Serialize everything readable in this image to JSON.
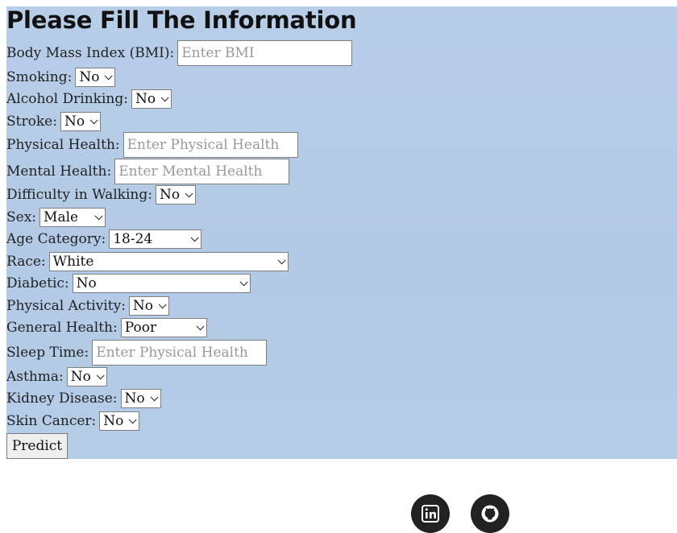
{
  "form": {
    "title": "Please Fill The Information",
    "bmi": {
      "label": "Body Mass Index (BMI):",
      "placeholder": "Enter BMI"
    },
    "smoking": {
      "label": "Smoking:",
      "value": "No"
    },
    "alcohol": {
      "label": "Alcohol Drinking:",
      "value": "No"
    },
    "stroke": {
      "label": "Stroke:",
      "value": "No"
    },
    "physical_health": {
      "label": "Physical Health:",
      "placeholder": "Enter Physical Health"
    },
    "mental_health": {
      "label": "Mental Health:",
      "placeholder": "Enter Mental Health"
    },
    "walking": {
      "label": "Difficulty in Walking:",
      "value": "No"
    },
    "sex": {
      "label": "Sex:",
      "value": "Male"
    },
    "age": {
      "label": "Age Category:",
      "value": "18-24"
    },
    "race": {
      "label": "Race:",
      "value": "White"
    },
    "diabetic": {
      "label": "Diabetic:",
      "value": "No"
    },
    "activity": {
      "label": "Physical Activity:",
      "value": "No"
    },
    "general_health": {
      "label": "General Health:",
      "value": "Poor"
    },
    "sleep": {
      "label": "Sleep Time:",
      "placeholder": "Enter Physical Health"
    },
    "asthma": {
      "label": "Asthma:",
      "value": "No"
    },
    "kidney": {
      "label": "Kidney Disease:",
      "value": "No"
    },
    "skin_cancer": {
      "label": "Skin Cancer:",
      "value": "No"
    },
    "predict_label": "Predict"
  },
  "footer": {
    "icons": [
      "linkedin-icon",
      "github-icon"
    ]
  }
}
